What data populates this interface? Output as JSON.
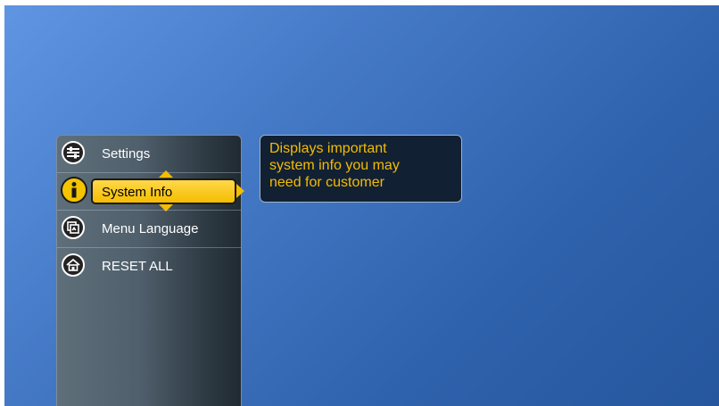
{
  "menu": {
    "items": [
      {
        "label": "Settings",
        "icon": "sliders-icon",
        "selected": false
      },
      {
        "label": "System Info",
        "icon": "info-icon",
        "selected": true
      },
      {
        "label": "Menu Language",
        "icon": "language-icon",
        "selected": false
      },
      {
        "label": "RESET ALL",
        "icon": "home-icon",
        "selected": false
      }
    ]
  },
  "description": {
    "lines": [
      "Displays important",
      "system info you may",
      "need for customer"
    ]
  },
  "colors": {
    "accent": "#f4bd00",
    "panel": "#3f4d57",
    "background": "#3f73c0",
    "info_box": "#122033"
  }
}
